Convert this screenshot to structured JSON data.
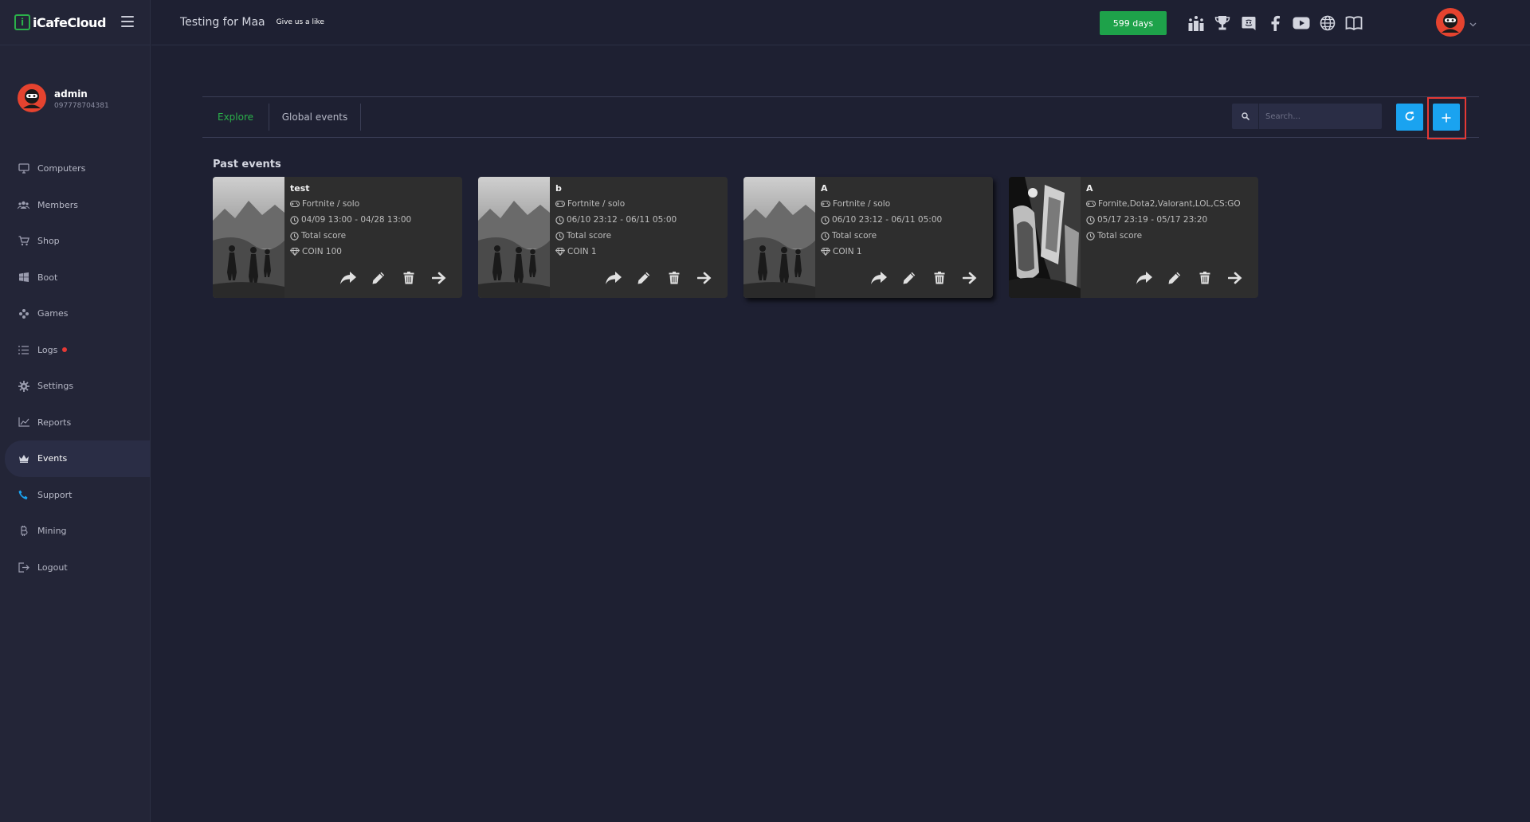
{
  "app": {
    "logo_text": "iCafeCloud",
    "logo_letter": "i"
  },
  "user": {
    "name": "admin",
    "phone": "097778704381"
  },
  "sidebar": {
    "items": [
      {
        "label": "Computers",
        "icon": "monitor-icon"
      },
      {
        "label": "Members",
        "icon": "members-icon"
      },
      {
        "label": "Shop",
        "icon": "cart-icon"
      },
      {
        "label": "Boot",
        "icon": "windows-icon"
      },
      {
        "label": "Games",
        "icon": "gamepad-icon"
      },
      {
        "label": "Logs",
        "icon": "list-icon"
      },
      {
        "label": "Settings",
        "icon": "gear-icon"
      },
      {
        "label": "Reports",
        "icon": "chart-line-icon"
      },
      {
        "label": "Events",
        "icon": "crown-icon"
      },
      {
        "label": "Support",
        "icon": "phone-icon"
      },
      {
        "label": "Mining",
        "icon": "bitcoin-icon"
      },
      {
        "label": "Logout",
        "icon": "logout-icon"
      }
    ]
  },
  "header": {
    "cafe_name": "Testing for Maa",
    "like_text": "Give us a like",
    "days_badge": "599 days",
    "icons": [
      "ranking-icon",
      "trophy-icon",
      "discord-icon",
      "facebook-icon",
      "youtube-icon",
      "globe-icon",
      "book-icon"
    ]
  },
  "toolbar": {
    "tabs": [
      {
        "label": "Explore",
        "active": true
      },
      {
        "label": "Global events",
        "active": false
      }
    ],
    "search_placeholder": "Search..."
  },
  "section": {
    "title": "Past events"
  },
  "events": [
    {
      "title": "test",
      "game": "Fortnite / solo",
      "time": "04/09 13:00 - 04/28 13:00",
      "score": "Total score",
      "reward": "COIN 100"
    },
    {
      "title": "b",
      "game": "Fortnite / solo",
      "time": "06/10 23:12 - 06/11 05:00",
      "score": "Total score",
      "reward": "COIN 1"
    },
    {
      "title": "A",
      "game": "Fortnite / solo",
      "time": "06/10 23:12 - 06/11 05:00",
      "score": "Total score",
      "reward": "COIN 1"
    },
    {
      "title": "A",
      "game": "Fornite,Dota2,Valorant,LOL,CS:GO",
      "time": "05/17 23:19 - 05/17 23:20",
      "score": "Total score",
      "reward": ""
    }
  ],
  "colors": {
    "accent_green": "#2bb04a",
    "accent_blue": "#1aa3f0",
    "highlight_red": "#e53935"
  }
}
